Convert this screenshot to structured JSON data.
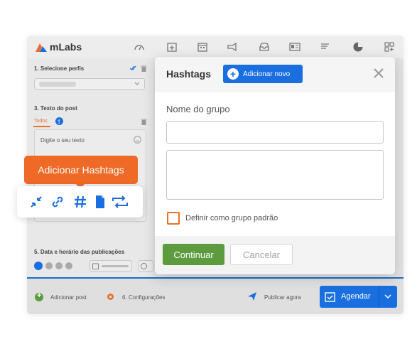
{
  "app": {
    "logo_text": "mLabs",
    "nav_icons": [
      "dashboard-icon",
      "calendar-add-icon",
      "calendar-icon",
      "megaphone-icon",
      "inbox-icon",
      "newspaper-icon",
      "notes-icon",
      "pie-chart-icon",
      "apps-icon"
    ]
  },
  "left_panel": {
    "section1_title": "1. Selecione perfis",
    "section3_title": "3. Texto do post",
    "tab_all": "Todos",
    "text_placeholder": "Digite o seu texto",
    "section5_title": "5. Data e horário das publicações"
  },
  "bottom_bar": {
    "add_post": "Adicionar post",
    "settings": "6. Configurações",
    "publish_now": "Publicar agora",
    "schedule": "Agendar"
  },
  "modal": {
    "title": "Hashtags",
    "add_new": "Adicionar novo",
    "group_name_label": "Nome do grupo",
    "default_group_label": "Definir como grupo padrão",
    "continue_label": "Continuar",
    "cancel_label": "Cancelar"
  },
  "tooltip": {
    "label": "Adicionar Hashtags"
  },
  "colors": {
    "primary_blue": "#1a6fe0",
    "orange": "#ee6a26",
    "green": "#5c9c3e"
  }
}
